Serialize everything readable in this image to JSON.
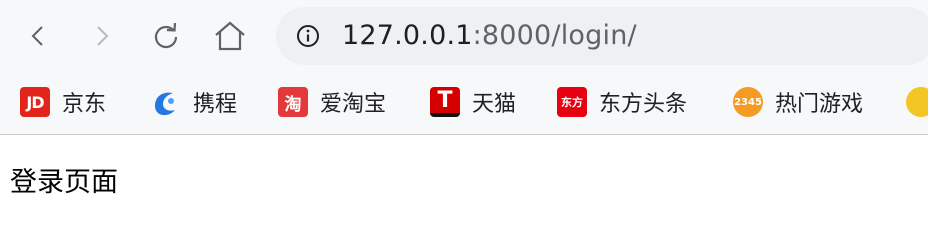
{
  "toolbar": {
    "url_host": "127.0.0.1",
    "url_rest": ":8000/login/"
  },
  "bookmarks": [
    {
      "label": "京东",
      "icon": "jd-icon",
      "icon_text": "JD",
      "color": "#e1251b"
    },
    {
      "label": "携程",
      "icon": "ctrip-icon",
      "color": "#2577e3"
    },
    {
      "label": "爱淘宝",
      "icon": "taobao-icon",
      "icon_text": "淘",
      "color": "#e4393c"
    },
    {
      "label": "天猫",
      "icon": "tmall-icon",
      "icon_text": "T",
      "color": "#d40000"
    },
    {
      "label": "东方头条",
      "icon": "dongfang-icon",
      "icon_text": "东方",
      "color": "#e60012"
    },
    {
      "label": "热门游戏",
      "icon": "games-icon",
      "icon_text": "2345",
      "color": "#f59a23"
    },
    {
      "icon": "extra-bookmark-icon",
      "color": "#f3c623"
    }
  ],
  "page": {
    "heading": "登录页面"
  }
}
